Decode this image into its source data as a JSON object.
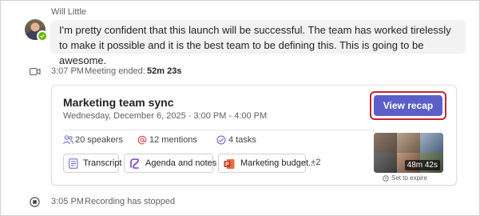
{
  "message": {
    "sender": "Will Little",
    "text": "I'm pretty confident that this launch will be successful. The team has worked tirelessly to make it possible and it is the best team to be defining this. This is going to be awesome.",
    "presence": "available"
  },
  "meeting_ended": {
    "icon": "video-camera-icon",
    "time": "3:07 PM",
    "label": "Meeting ended:",
    "duration": "52m 23s"
  },
  "card": {
    "title": "Marketing team sync",
    "subtitle": "Wednesday, December 6, 2025 · 3:00 PM - 4:00 PM",
    "recap_button": "View recap",
    "stats": {
      "speakers": "20 speakers",
      "mentions": "12 mentions",
      "tasks": "4 tasks"
    },
    "files": [
      {
        "label": "Transcript",
        "icon": "transcript-icon"
      },
      {
        "label": "Agenda and notes",
        "icon": "loop-icon"
      },
      {
        "label": "Marketing budget...",
        "icon": "powerpoint-icon"
      }
    ],
    "more_files": "+2",
    "recording_duration": "48m 42s",
    "expire_label": "Set to expire"
  },
  "recording_stopped": {
    "icon": "record-stop-icon",
    "time": "3:05 PM",
    "label": "Recording has stopped"
  },
  "colors": {
    "accent": "#5b5fc7",
    "highlight_outline": "#c4262e",
    "presence_available": "#6bb700",
    "mention": "#d13438",
    "powerpoint": "#c43e1c"
  }
}
